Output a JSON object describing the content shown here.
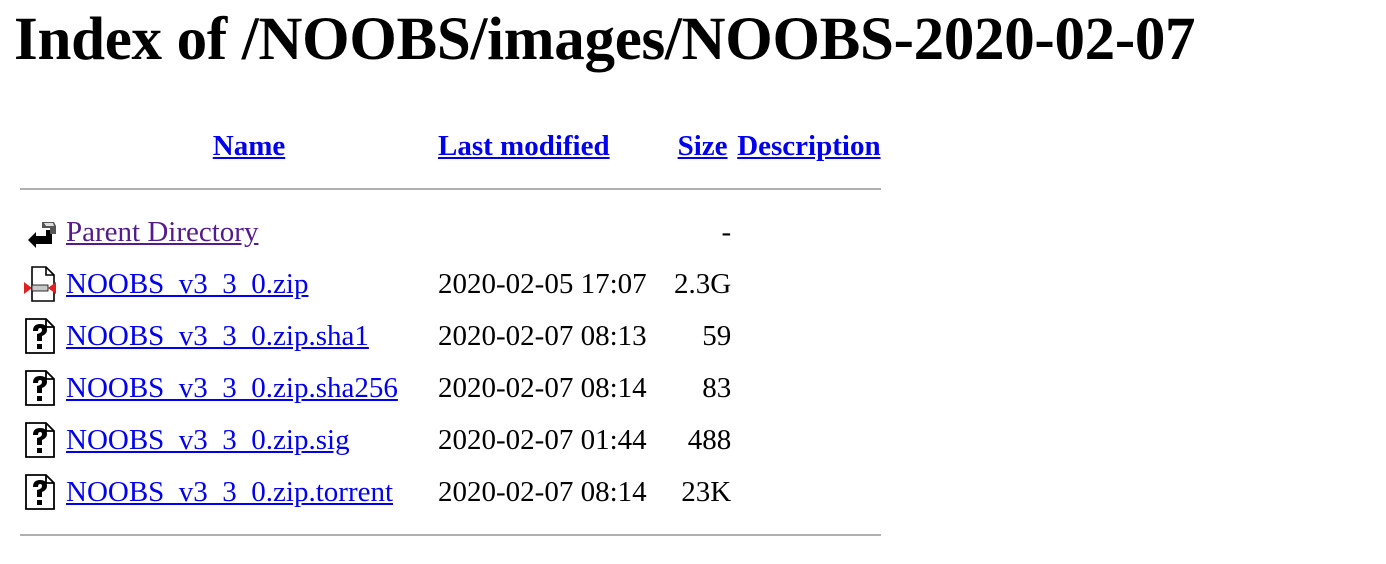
{
  "page": {
    "title": "Index of /NOOBS/images/NOOBS-2020-02-07"
  },
  "columns": {
    "name": "Name",
    "last_modified": "Last modified",
    "size": "Size",
    "description": "Description"
  },
  "entries": [
    {
      "icon": "back-arrow-icon",
      "name": "Parent Directory",
      "modified": "",
      "size": "-",
      "description": "",
      "visited": true
    },
    {
      "icon": "archive-file-icon",
      "name": "NOOBS_v3_3_0.zip",
      "modified": "2020-02-05 17:07",
      "size": "2.3G",
      "description": ""
    },
    {
      "icon": "unknown-file-icon",
      "name": "NOOBS_v3_3_0.zip.sha1",
      "modified": "2020-02-07 08:13",
      "size": "59",
      "description": ""
    },
    {
      "icon": "unknown-file-icon",
      "name": "NOOBS_v3_3_0.zip.sha256",
      "modified": "2020-02-07 08:14",
      "size": "83",
      "description": ""
    },
    {
      "icon": "unknown-file-icon",
      "name": "NOOBS_v3_3_0.zip.sig",
      "modified": "2020-02-07 01:44",
      "size": "488",
      "description": ""
    },
    {
      "icon": "unknown-file-icon",
      "name": "NOOBS_v3_3_0.zip.torrent",
      "modified": "2020-02-07 08:14",
      "size": "23K",
      "description": ""
    }
  ],
  "colors": {
    "link": "#0000ee",
    "visited_link": "#551a8b",
    "rule": "#b0b0b0"
  }
}
